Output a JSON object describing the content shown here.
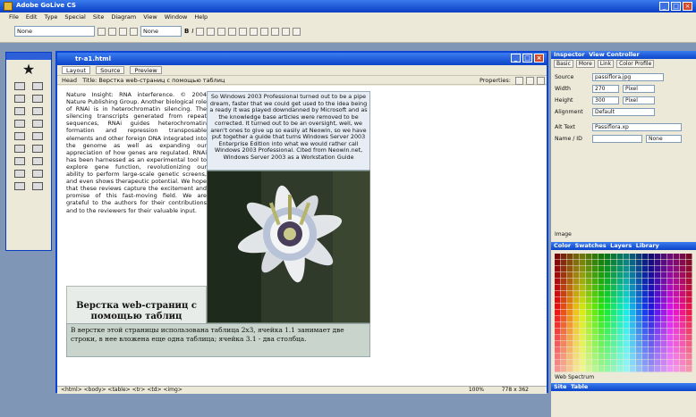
{
  "app": {
    "title": "Adobe GoLive CS",
    "menu": [
      "File",
      "Edit",
      "Type",
      "Special",
      "Site",
      "Diagram",
      "View",
      "Window",
      "Help"
    ]
  },
  "toolbar": {
    "style_select": "None",
    "font_select": "None",
    "bold": "B",
    "italic": "I"
  },
  "document": {
    "window_title": "tr-a1.html",
    "tabs": [
      "Layout",
      "Source",
      "Preview"
    ],
    "head_label": "Head",
    "title_label": "Title:",
    "title_value": "Верстка web-страниц с помощью таблиц",
    "properties_label": "Properties:",
    "left_text": "Nature Insight: RNA interference. © 2004 Nature Publishing Group. Another biological role of RNAi is in heterochromatin silencing. The silencing transcripts generated from repeat sequences, RNAi guides heterochromatin formation and repression transposable elements and other foreign DNA integrated into the genome as well as expanding our appreciation of how genes are regulated. RNAi has been harnessed as an experimental tool to explore gene function, revolutionizing our ability to perform large-scale genetic screens, and even shows therapeutic potential. We hope that these reviews capture the excitement and promise of this fast-moving field. We are grateful to the authors for their contributions and to the reviewers for their valuable input.",
    "right_text": "So Windows 2003 Professional turned out to be a pipe dream, faster that we could get used to the idea being a ready it was played downdanned by Microsoft and as the knowledge base articles were removed to be corrected. It turned out to be an oversight, well, we aren't ones to give up so easily at Neowin, so we have put together a guide that turns Windows Server 2003 Enterprise Edition into what we would rather call Windows 2003 Professional. Cited from Neowin.net, Windows Server 2003 as a Workstation Guide",
    "header_cell": "Верстка web-страниц с помощью таблиц",
    "bottom_text": "В верстке этой страницы использована таблица 2х3, ячейка 1.1 занимает две строки, в нее вложена еще одна таблица; ячейка 3.1 - два столбца.",
    "status_path": "<html> <body> <table> <tr> <td> <img>",
    "zoom": "100%",
    "size": "778 x 362"
  },
  "inspector": {
    "tabs": [
      "Inspector",
      "View Controller"
    ],
    "subtabs": [
      "Basic",
      "More",
      "Link",
      "Color Profile"
    ],
    "source_label": "Source",
    "source_value": "passiflora.jpg",
    "width_label": "Width",
    "width_value": "270",
    "height_label": "Height",
    "height_value": "300",
    "unit": "Pixel",
    "alignment_label": "Alignment",
    "alignment_value": "Default",
    "alt_label": "Alt Text",
    "alt_value": "Passiflora.xp",
    "name_label": "Name / ID",
    "name_value": "None",
    "image_label": "Image"
  },
  "swatches": {
    "tabs": [
      "Color",
      "Swatches",
      "Layers",
      "Library"
    ],
    "footer": "Web Spectrum",
    "bottom_tabs": [
      "Site",
      "Table"
    ]
  },
  "colors": {
    "title_blue": "#0c44c8",
    "chrome": "#ece9d8",
    "desktop": "#7f96b7"
  }
}
